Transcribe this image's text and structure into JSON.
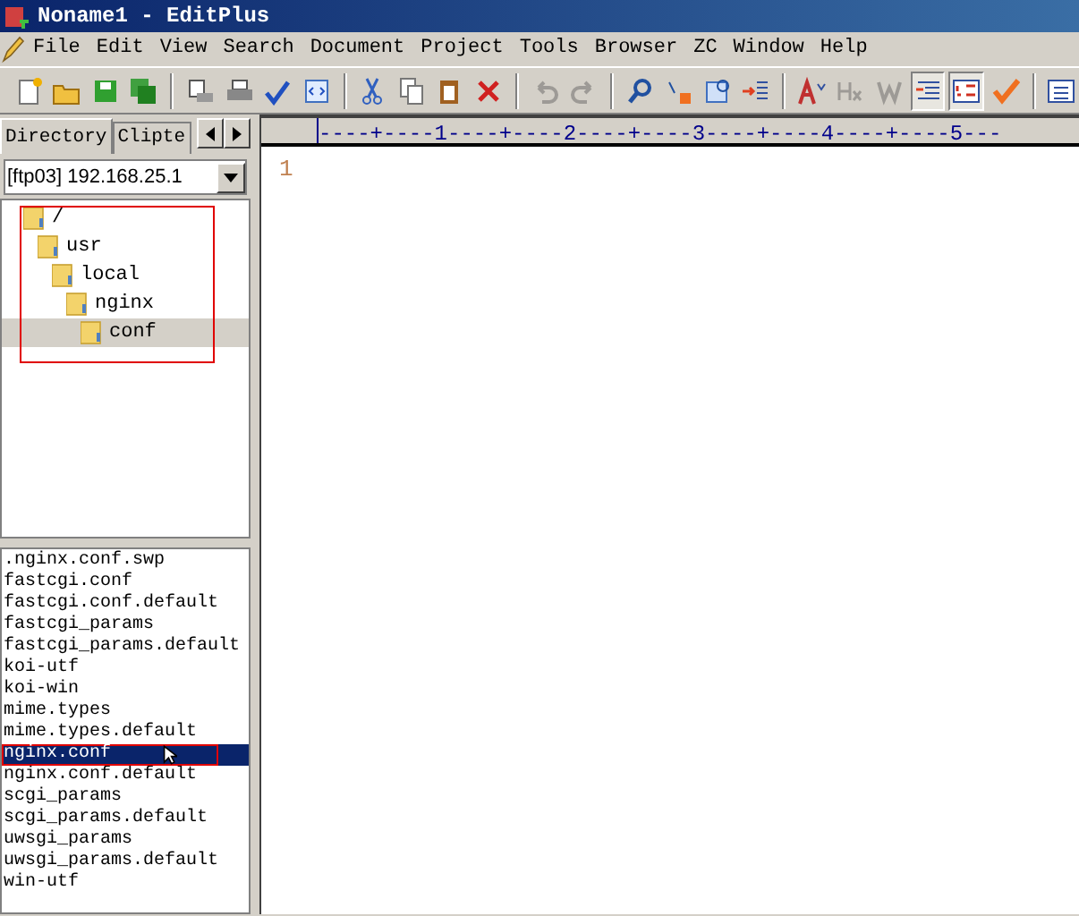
{
  "window": {
    "title": "Noname1 - EditPlus"
  },
  "menu": [
    "File",
    "Edit",
    "View",
    "Search",
    "Document",
    "Project",
    "Tools",
    "Browser",
    "ZC",
    "Window",
    "Help"
  ],
  "toolbar": [
    [
      {
        "kind": "new",
        "disabled": false,
        "pressed": false
      },
      {
        "kind": "open",
        "disabled": false,
        "pressed": false
      },
      {
        "kind": "save",
        "disabled": false,
        "pressed": false
      },
      {
        "kind": "saveall",
        "disabled": false,
        "pressed": false
      }
    ],
    [
      {
        "kind": "preview",
        "disabled": false,
        "pressed": false
      },
      {
        "kind": "print",
        "disabled": false,
        "pressed": false
      },
      {
        "kind": "spell",
        "disabled": false,
        "pressed": false
      },
      {
        "kind": "browser",
        "disabled": false,
        "pressed": false
      }
    ],
    [
      {
        "kind": "cut",
        "disabled": false,
        "pressed": false
      },
      {
        "kind": "copy",
        "disabled": false,
        "pressed": false
      },
      {
        "kind": "paste",
        "disabled": false,
        "pressed": false
      },
      {
        "kind": "delete",
        "disabled": false,
        "pressed": false
      }
    ],
    [
      {
        "kind": "undo",
        "disabled": true,
        "pressed": false
      },
      {
        "kind": "redo",
        "disabled": true,
        "pressed": false
      }
    ],
    [
      {
        "kind": "find",
        "disabled": false,
        "pressed": false
      },
      {
        "kind": "replace",
        "disabled": false,
        "pressed": false
      },
      {
        "kind": "goto",
        "disabled": false,
        "pressed": false
      },
      {
        "kind": "indent",
        "disabled": false,
        "pressed": false
      }
    ],
    [
      {
        "kind": "font",
        "disabled": false,
        "pressed": false
      },
      {
        "kind": "hx",
        "disabled": true,
        "pressed": false
      },
      {
        "kind": "word",
        "disabled": true,
        "pressed": false
      },
      {
        "kind": "wrap",
        "disabled": false,
        "pressed": true
      },
      {
        "kind": "linenum",
        "disabled": false,
        "pressed": true
      },
      {
        "kind": "check",
        "disabled": false,
        "pressed": false
      }
    ],
    [
      {
        "kind": "list",
        "disabled": false,
        "pressed": false
      }
    ]
  ],
  "sidebar": {
    "tabs": [
      {
        "label": "Directory",
        "selected": true
      },
      {
        "label": "Clipte",
        "selected": false
      }
    ],
    "drive_select": {
      "value": "[ftp03] 192.168.25.1"
    },
    "tree": [
      {
        "label": "/",
        "selected": false,
        "children": [
          {
            "label": "usr",
            "selected": false,
            "children": [
              {
                "label": "local",
                "selected": false,
                "children": [
                  {
                    "label": "nginx",
                    "selected": false,
                    "children": [
                      {
                        "label": "conf",
                        "selected": true
                      }
                    ]
                  }
                ]
              }
            ]
          }
        ]
      }
    ],
    "files": [
      {
        "name": ".nginx.conf.swp",
        "selected": false
      },
      {
        "name": "fastcgi.conf",
        "selected": false
      },
      {
        "name": "fastcgi.conf.default",
        "selected": false
      },
      {
        "name": "fastcgi_params",
        "selected": false
      },
      {
        "name": "fastcgi_params.default",
        "selected": false
      },
      {
        "name": "koi-utf",
        "selected": false
      },
      {
        "name": "koi-win",
        "selected": false
      },
      {
        "name": "mime.types",
        "selected": false
      },
      {
        "name": "mime.types.default",
        "selected": false
      },
      {
        "name": "nginx.conf",
        "selected": true
      },
      {
        "name": "nginx.conf.default",
        "selected": false
      },
      {
        "name": "scgi_params",
        "selected": false
      },
      {
        "name": "scgi_params.default",
        "selected": false
      },
      {
        "name": "uwsgi_params",
        "selected": false
      },
      {
        "name": "uwsgi_params.default",
        "selected": false
      },
      {
        "name": "win-utf",
        "selected": false
      }
    ]
  },
  "editor": {
    "ruler": "----+----1----+----2----+----3----+----4----+----5---",
    "line_numbers": [
      "1"
    ]
  }
}
